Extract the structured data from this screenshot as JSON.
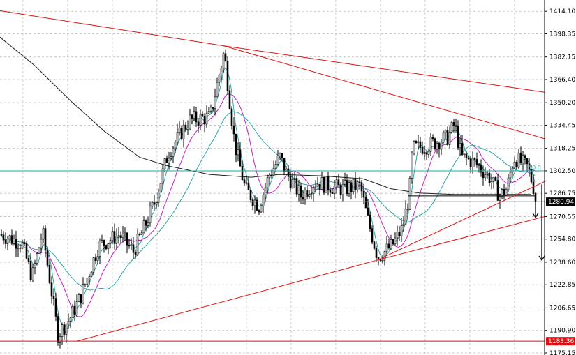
{
  "chart_data": {
    "type": "candlestick",
    "grid": true,
    "ylim": [
      1175.15,
      1422.0
    ],
    "y_ticks": [
      "1414.10",
      "1398.35",
      "1382.15",
      "1366.40",
      "1350.20",
      "1334.45",
      "1318.25",
      "1302.50",
      "1286.75",
      "1270.55",
      "1254.80",
      "1238.60",
      "1222.85",
      "1206.65",
      "1190.90",
      "1175.15"
    ],
    "price_tags": [
      {
        "text": "1280.94",
        "value": 1280.94,
        "color": "#000000"
      },
      {
        "text": "1183.36",
        "value": 1183.36,
        "color": "#e01010"
      }
    ],
    "level_label": {
      "text": "50.0",
      "value": 1302.5
    },
    "levels": [
      {
        "name": "horizontal-support",
        "value": 1183.36,
        "color": "#e01010"
      },
      {
        "name": "fib-50",
        "value": 1302.5,
        "color": "#2aa6a6"
      },
      {
        "name": "current-price",
        "value": 1280.94,
        "color": "#909090"
      },
      {
        "name": "neckline",
        "value": 1285.0,
        "color": "#000000"
      }
    ],
    "trendlines": [
      {
        "name": "upper-resistance",
        "points": [
          [
            0,
            1414.5
          ],
          [
            320,
            1390.0
          ],
          [
            780,
            1357.5
          ]
        ],
        "color": "#e01010"
      },
      {
        "name": "inner-resistance",
        "points": [
          [
            320,
            1390.0
          ],
          [
            780,
            1325.0
          ]
        ],
        "color": "#e01010"
      },
      {
        "name": "lower-support",
        "points": [
          [
            110,
            1183.36
          ],
          [
            540,
            1240.0
          ],
          [
            780,
            1295.0
          ]
        ],
        "color": "#e01010"
      },
      {
        "name": "channel-support",
        "points": [
          [
            540,
            1240.0
          ],
          [
            780,
            1270.5
          ]
        ],
        "color": "#e01010"
      }
    ],
    "arrows": [
      {
        "name": "short-arrow",
        "from": [
          767,
          1285.0
        ],
        "to": [
          767,
          1270.0
        ]
      },
      {
        "name": "long-arrow",
        "from": [
          776,
          1293.0
        ],
        "to": [
          776,
          1240.0
        ]
      }
    ],
    "keypoints": [
      [
        0,
        1258
      ],
      [
        30,
        1252
      ],
      [
        45,
        1228
      ],
      [
        60,
        1260
      ],
      [
        82,
        1188
      ],
      [
        100,
        1200
      ],
      [
        115,
        1215
      ],
      [
        140,
        1250
      ],
      [
        170,
        1258
      ],
      [
        190,
        1246
      ],
      [
        205,
        1262
      ],
      [
        220,
        1280
      ],
      [
        240,
        1315
      ],
      [
        270,
        1338
      ],
      [
        300,
        1340
      ],
      [
        320,
        1386
      ],
      [
        335,
        1322
      ],
      [
        350,
        1290
      ],
      [
        370,
        1278
      ],
      [
        385,
        1300
      ],
      [
        400,
        1312
      ],
      [
        410,
        1300
      ],
      [
        430,
        1285
      ],
      [
        450,
        1295
      ],
      [
        470,
        1292
      ],
      [
        490,
        1290
      ],
      [
        515,
        1292
      ],
      [
        525,
        1270
      ],
      [
        540,
        1242
      ],
      [
        560,
        1250
      ],
      [
        575,
        1262
      ],
      [
        585,
        1285
      ],
      [
        590,
        1318
      ],
      [
        610,
        1320
      ],
      [
        640,
        1326
      ],
      [
        650,
        1335
      ],
      [
        660,
        1312
      ],
      [
        680,
        1308
      ],
      [
        700,
        1298
      ],
      [
        715,
        1285
      ],
      [
        725,
        1290
      ],
      [
        735,
        1312
      ],
      [
        755,
        1305
      ],
      [
        765,
        1288
      ],
      [
        770,
        1280.94
      ]
    ],
    "moving_averages": [
      {
        "name": "sma-fast",
        "color": "#2aa6a6",
        "period": 5
      },
      {
        "name": "sma-mid",
        "color": "#c020c0",
        "period": 14
      },
      {
        "name": "sma-slow",
        "color": "#2aa6a6",
        "period": 30
      },
      {
        "name": "sma-long",
        "color": "#202020",
        "points": [
          [
            0,
            1396
          ],
          [
            50,
            1376
          ],
          [
            100,
            1352
          ],
          [
            150,
            1330
          ],
          [
            200,
            1312
          ],
          [
            240,
            1306
          ],
          [
            300,
            1300
          ],
          [
            360,
            1298
          ],
          [
            400,
            1300
          ],
          [
            460,
            1299
          ],
          [
            520,
            1297
          ],
          [
            560,
            1290
          ],
          [
            600,
            1287
          ],
          [
            650,
            1286
          ],
          [
            700,
            1286
          ],
          [
            760,
            1286
          ]
        ]
      }
    ]
  }
}
